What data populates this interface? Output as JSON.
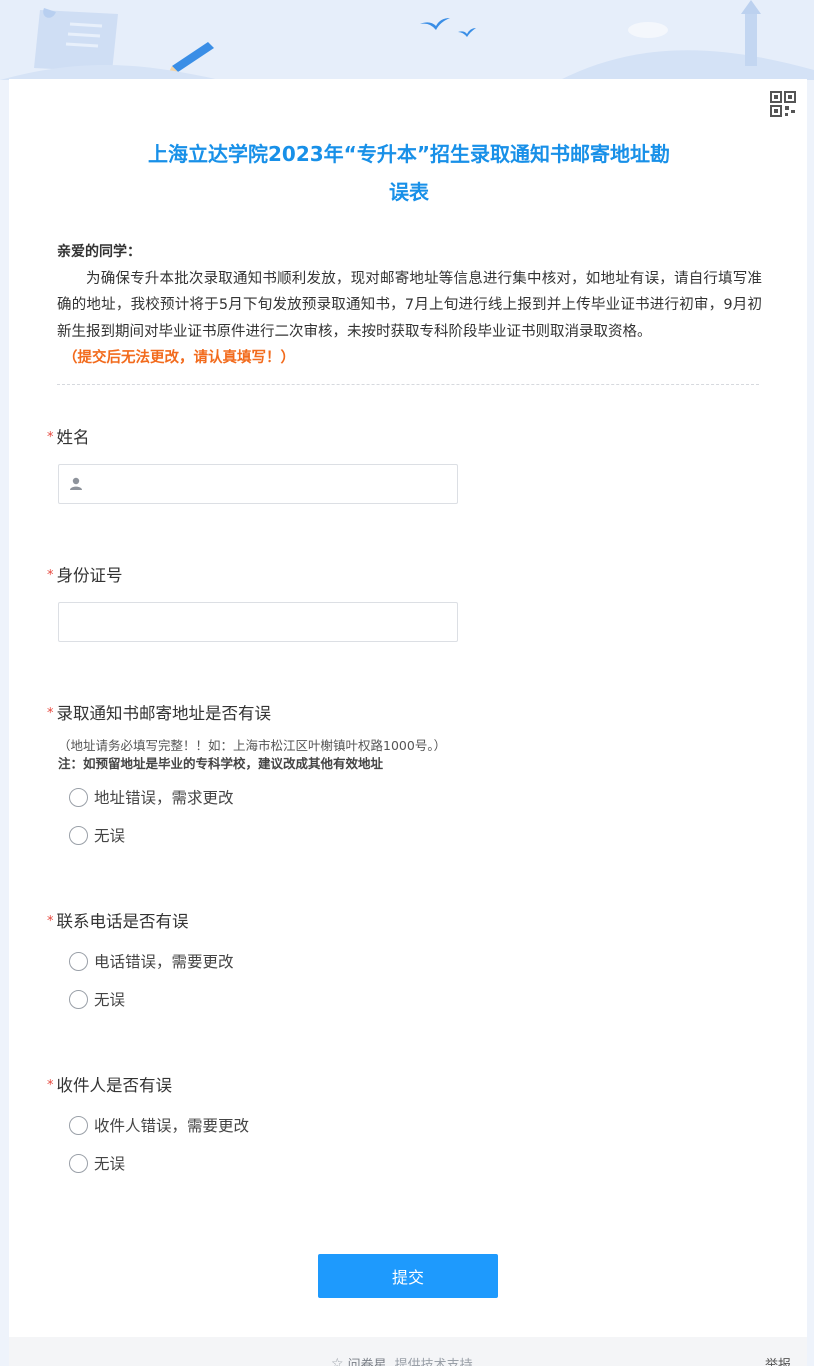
{
  "form": {
    "title": "上海立达学院2023年“专升本”招生录取通知书邮寄地址勘误表",
    "greeting": "亲爱的同学：",
    "intro": "为确保专升本批次录取通知书顺利发放，现对邮寄地址等信息进行集中核对，如地址有误，请自行填写准确的地址，我校预计将于5月下旬发放预录取通知书，7月上旬进行线上报到并上传毕业证书进行初审，9月初新生报到期间对毕业证书原件进行二次审核，未按时获取专科阶段毕业证书则取消录取资格。",
    "warning": "（提交后无法更改，请认真填写！）",
    "required_mark": "*"
  },
  "questions": {
    "name": {
      "label": "姓名",
      "value": "",
      "icon": "user-icon"
    },
    "idcard": {
      "label": "身份证号",
      "value": ""
    },
    "address": {
      "label": "录取通知书邮寄地址是否有误",
      "hint": "（地址请务必填写完整！！如：上海市松江区叶榭镇叶权路1000号。）",
      "note": "注：如预留地址是毕业的专科学校，建议改成其他有效地址",
      "options": [
        "地址错误，需求更改",
        "无误"
      ]
    },
    "phone": {
      "label": "联系电话是否有误",
      "options": [
        "电话错误，需要更改",
        "无误"
      ]
    },
    "recipient": {
      "label": "收件人是否有误",
      "options": [
        "收件人错误，需要更改",
        "无误"
      ]
    }
  },
  "actions": {
    "submit_label": "提交"
  },
  "footer": {
    "brand": "问卷星",
    "support": "提供技术支持",
    "report": "举报"
  },
  "colors": {
    "accent": "#1890e8",
    "button": "#1e9afd",
    "warning": "#f26b1d",
    "required": "#e6463c"
  },
  "icons": {
    "qr": "qr-code-icon",
    "star": "star-icon"
  }
}
